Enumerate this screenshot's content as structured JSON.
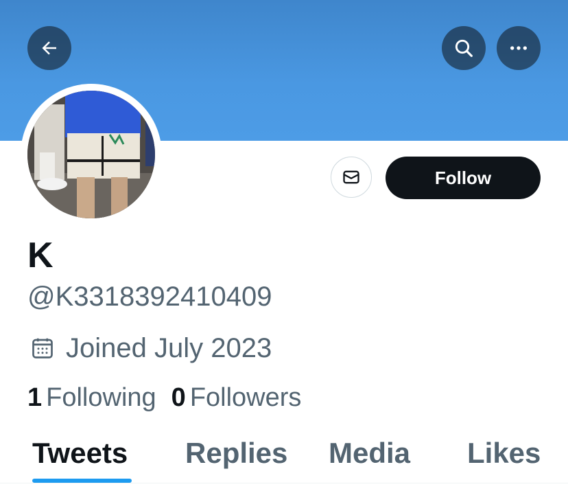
{
  "header": {
    "back_icon": "arrow-left-icon",
    "search_icon": "search-icon",
    "more_icon": "more-horizontal-icon",
    "banner_color": "#4a98e2"
  },
  "profile": {
    "display_name": "K",
    "handle": "@K3318392410409",
    "joined": "Joined July 2023",
    "joined_icon": "calendar-icon",
    "following_count": "1",
    "following_label": "Following",
    "followers_count": "0",
    "followers_label": "Followers"
  },
  "actions": {
    "message_icon": "envelope-icon",
    "follow_label": "Follow"
  },
  "tabs": [
    {
      "label": "Tweets",
      "active": true
    },
    {
      "label": "Replies",
      "active": false
    },
    {
      "label": "Media",
      "active": false
    },
    {
      "label": "Likes",
      "active": false
    }
  ],
  "colors": {
    "accent": "#1d9bf0",
    "primary_text": "#0f1419",
    "secondary_text": "#536471"
  }
}
